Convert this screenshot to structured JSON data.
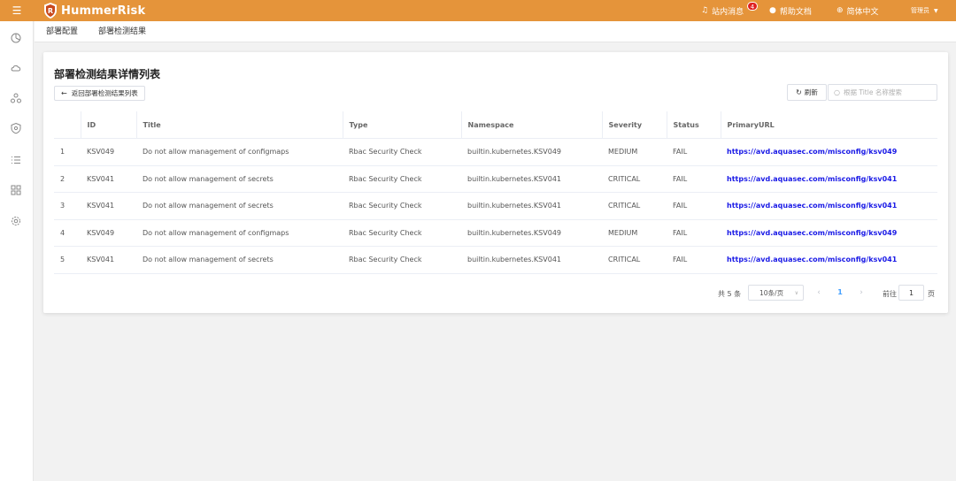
{
  "header": {
    "logo_text": "HummerRisk",
    "messages_label": "站内消息",
    "messages_count": "4",
    "help_label": "帮助文档",
    "language_label": "简体中文",
    "user_label": "管理员"
  },
  "colors": {
    "header_bg": "#e5943a",
    "link": "#1a1ae6",
    "page_active": "#409eff",
    "badge": "#e02020"
  },
  "breadcrumb": {
    "items": [
      "部署配置",
      "部署检测结果"
    ]
  },
  "card": {
    "title": "部署检测结果详情列表",
    "back_label": "返回部署检测结果列表",
    "refresh_label": "刷新",
    "search_placeholder": "根据 Title 名称搜索"
  },
  "table": {
    "columns": [
      "",
      "ID",
      "Title",
      "Type",
      "Namespace",
      "Severity",
      "Status",
      "PrimaryURL"
    ],
    "rows": [
      [
        "1",
        "KSV049",
        "Do not allow management of configmaps",
        "Rbac Security Check",
        "builtin.kubernetes.KSV049",
        "MEDIUM",
        "FAIL",
        "https://avd.aquasec.com/misconfig/ksv049"
      ],
      [
        "2",
        "KSV041",
        "Do not allow management of secrets",
        "Rbac Security Check",
        "builtin.kubernetes.KSV041",
        "CRITICAL",
        "FAIL",
        "https://avd.aquasec.com/misconfig/ksv041"
      ],
      [
        "3",
        "KSV041",
        "Do not allow management of secrets",
        "Rbac Security Check",
        "builtin.kubernetes.KSV041",
        "CRITICAL",
        "FAIL",
        "https://avd.aquasec.com/misconfig/ksv041"
      ],
      [
        "4",
        "KSV049",
        "Do not allow management of configmaps",
        "Rbac Security Check",
        "builtin.kubernetes.KSV049",
        "MEDIUM",
        "FAIL",
        "https://avd.aquasec.com/misconfig/ksv049"
      ],
      [
        "5",
        "KSV041",
        "Do not allow management of secrets",
        "Rbac Security Check",
        "builtin.kubernetes.KSV041",
        "CRITICAL",
        "FAIL",
        "https://avd.aquasec.com/misconfig/ksv041"
      ]
    ]
  },
  "pagination": {
    "total_label": "共 5 条",
    "page_size": "10条/页",
    "current_page": "1",
    "goto_label": "前往",
    "goto_value": "1",
    "page_suffix": "页"
  },
  "rail_icons": [
    "dashboard-icon",
    "cloud-icon",
    "cluster-icon",
    "shield-icon",
    "list-icon",
    "apps-icon",
    "settings-icon"
  ]
}
